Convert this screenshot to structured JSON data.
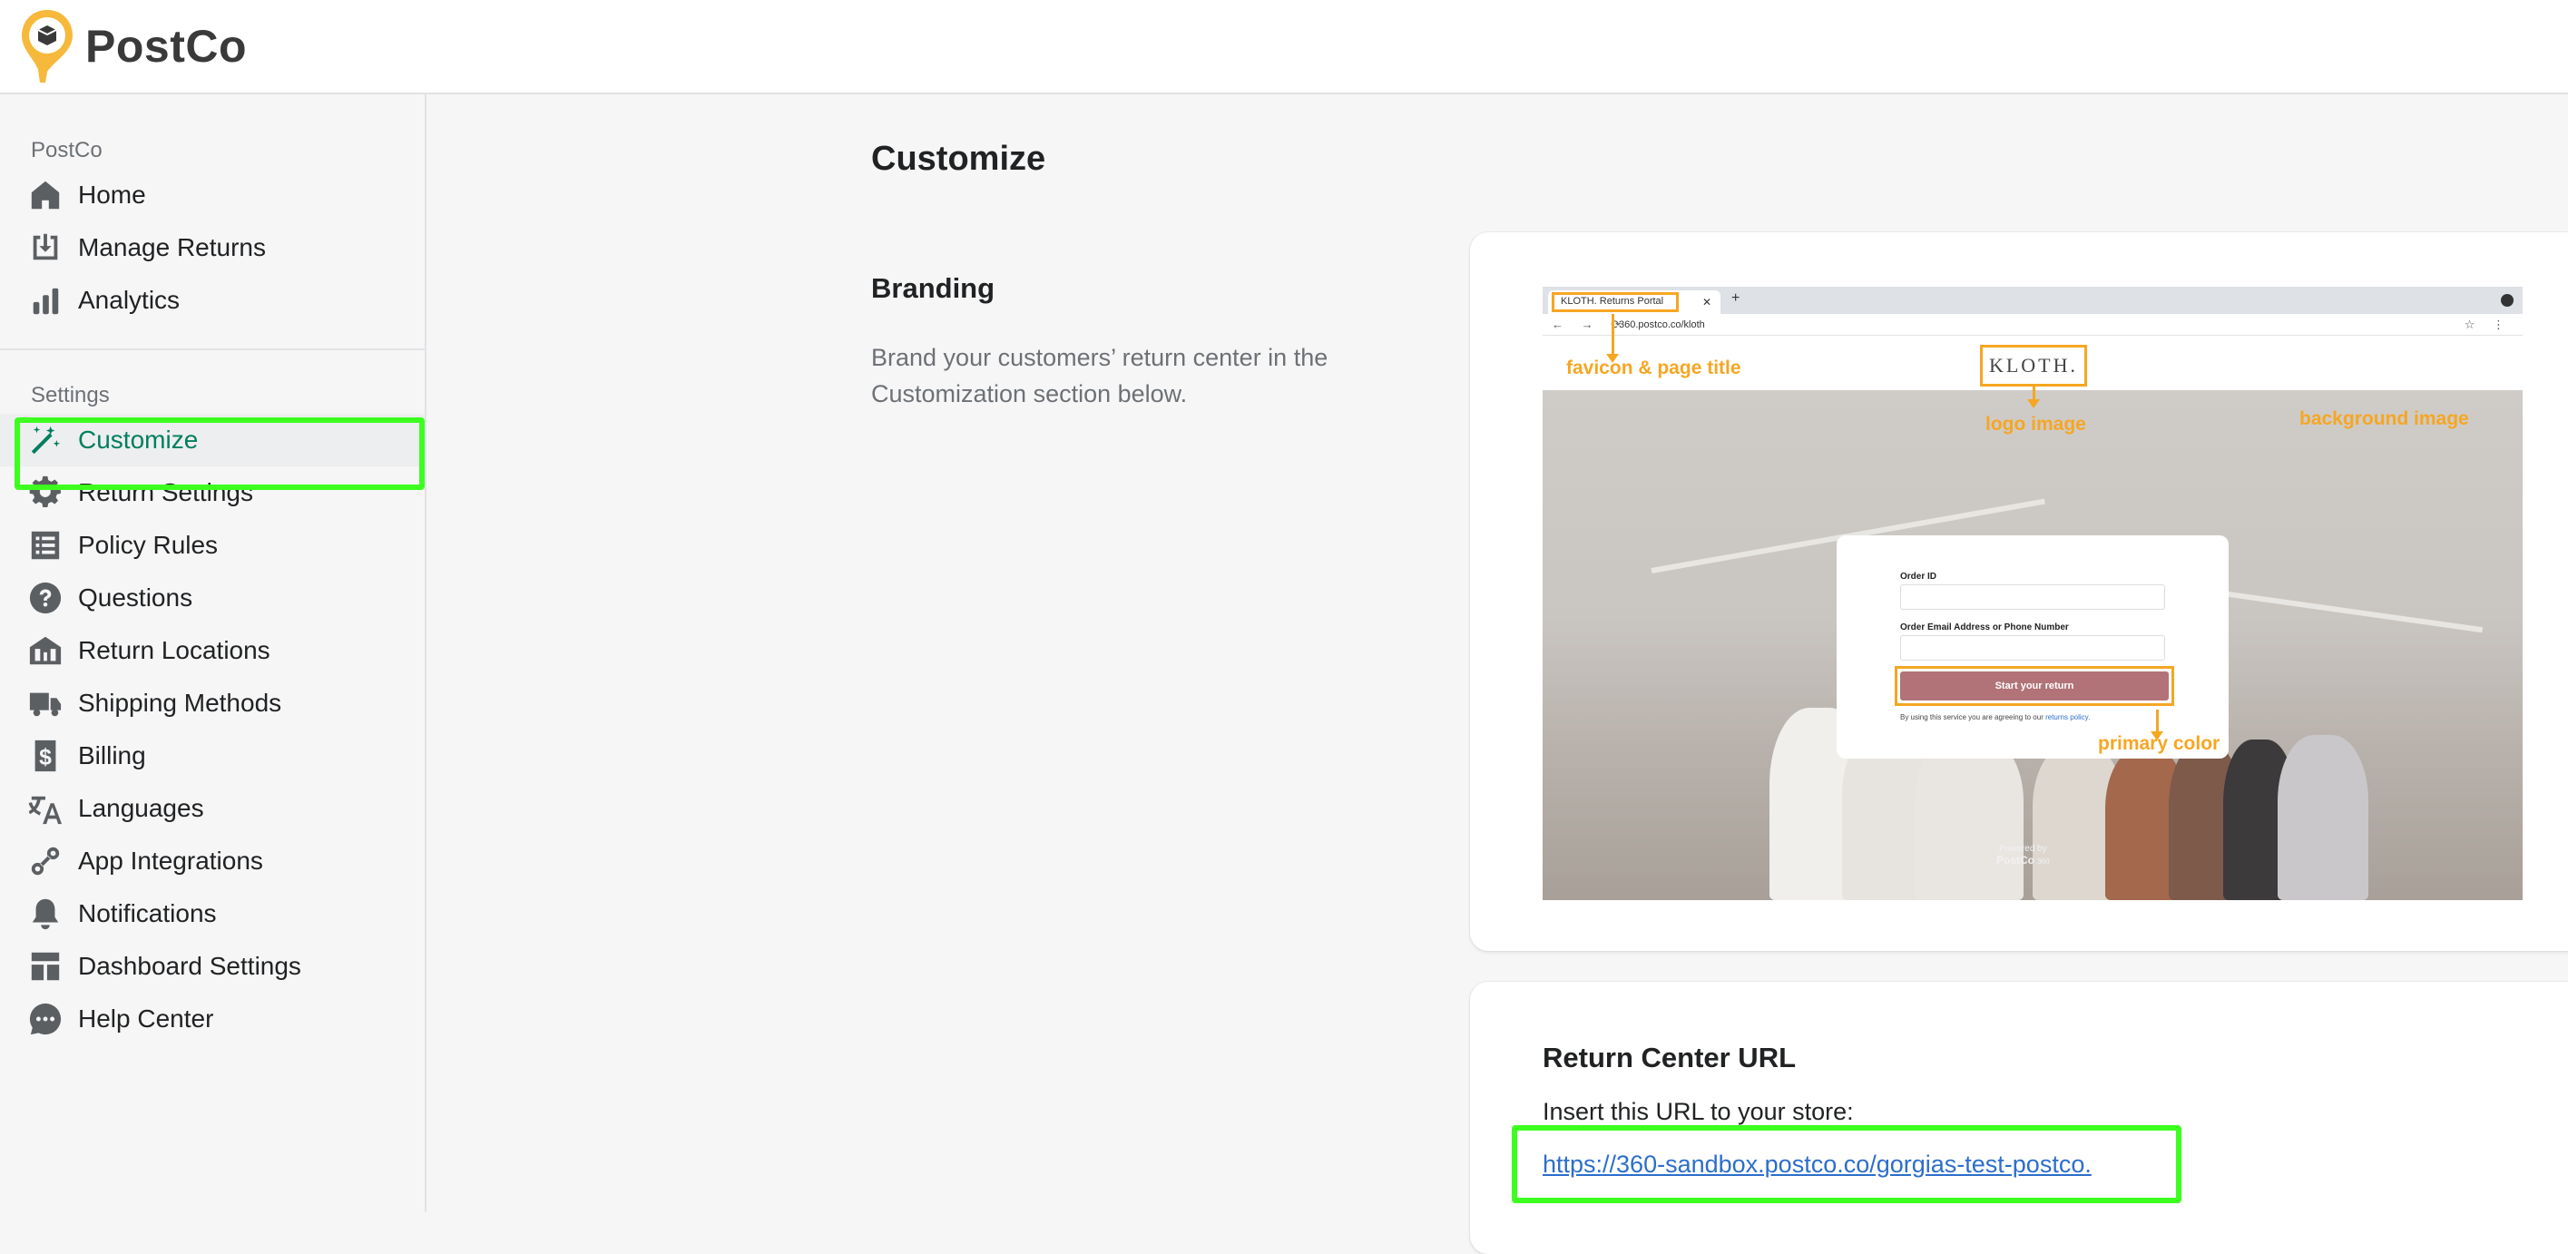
{
  "brand": {
    "name": "PostCo",
    "accent": "#007f5f",
    "highlight": "#3dff1f"
  },
  "sidebar": {
    "section1_title": "PostCo",
    "section1_items": [
      {
        "label": "Home",
        "icon": "home-icon"
      },
      {
        "label": "Manage Returns",
        "icon": "inbox-download-icon"
      },
      {
        "label": "Analytics",
        "icon": "bar-chart-icon"
      }
    ],
    "section2_title": "Settings",
    "section2_items": [
      {
        "label": "Customize",
        "icon": "magic-wand-icon",
        "active": true
      },
      {
        "label": "Return Settings",
        "icon": "gear-icon"
      },
      {
        "label": "Policy Rules",
        "icon": "list-icon"
      },
      {
        "label": "Questions",
        "icon": "question-circle-icon"
      },
      {
        "label": "Return Locations",
        "icon": "building-icon"
      },
      {
        "label": "Shipping Methods",
        "icon": "truck-icon"
      },
      {
        "label": "Billing",
        "icon": "dollar-receipt-icon"
      },
      {
        "label": "Languages",
        "icon": "translate-icon"
      },
      {
        "label": "App Integrations",
        "icon": "integration-icon"
      },
      {
        "label": "Notifications",
        "icon": "bell-icon"
      },
      {
        "label": "Dashboard Settings",
        "icon": "layout-icon"
      },
      {
        "label": "Help Center",
        "icon": "chat-bubble-icon"
      }
    ]
  },
  "main": {
    "title": "Customize",
    "branding": {
      "heading": "Branding",
      "description": "Brand your customers’ return center in the Customization section below."
    },
    "preview": {
      "tab_title": "KLOTH. Returns Portal",
      "address": "360.postco.co/kloth",
      "logo_text": "KLOTH.",
      "annotations": {
        "favicon": "favicon & page title",
        "logo": "logo image",
        "background": "background image",
        "primary": "primary color"
      },
      "form": {
        "order_id_label": "Order ID",
        "email_label": "Order Email Address or Phone Number",
        "button_label": "Start your return",
        "terms_prefix": "By using this service you are agreeing to our ",
        "terms_link": "returns policy."
      },
      "powered_by": "Powered by",
      "powered_brand": "PostCo",
      "powered_suffix": "360"
    },
    "return_center": {
      "heading": "Return Center URL",
      "instruction": "Insert this URL to your store:",
      "url": "https://360-sandbox.postco.co/gorgias-test-postco."
    }
  }
}
